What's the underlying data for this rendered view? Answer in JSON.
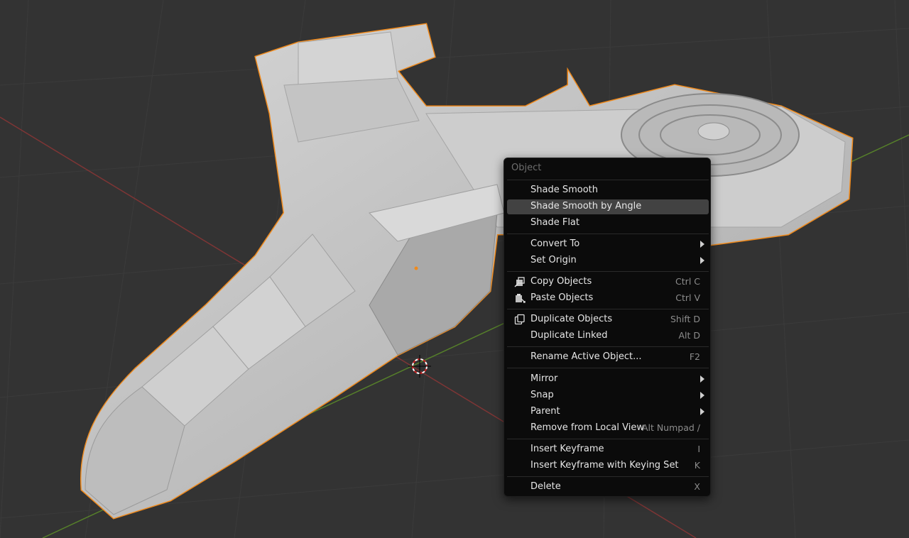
{
  "context_menu": {
    "title": "Object",
    "items": [
      {
        "label": "Shade Smooth",
        "shortcut": "",
        "submenu": false
      },
      {
        "label": "Shade Smooth by Angle",
        "shortcut": "",
        "submenu": false,
        "highlighted": true
      },
      {
        "label": "Shade Flat",
        "shortcut": "",
        "submenu": false
      },
      {
        "label": "Convert To",
        "shortcut": "",
        "submenu": true
      },
      {
        "label": "Set Origin",
        "shortcut": "",
        "submenu": true
      },
      {
        "label": "Copy Objects",
        "shortcut": "Ctrl C",
        "submenu": false,
        "icon": "copy-icon"
      },
      {
        "label": "Paste Objects",
        "shortcut": "Ctrl V",
        "submenu": false,
        "icon": "paste-icon"
      },
      {
        "label": "Duplicate Objects",
        "shortcut": "Shift D",
        "submenu": false,
        "icon": "duplicate-icon"
      },
      {
        "label": "Duplicate Linked",
        "shortcut": "Alt D",
        "submenu": false
      },
      {
        "label": "Rename Active Object...",
        "shortcut": "F2",
        "submenu": false
      },
      {
        "label": "Mirror",
        "shortcut": "",
        "submenu": true
      },
      {
        "label": "Snap",
        "shortcut": "",
        "submenu": true
      },
      {
        "label": "Parent",
        "shortcut": "",
        "submenu": true
      },
      {
        "label": "Remove from Local View",
        "shortcut": "Alt Numpad /",
        "submenu": false
      },
      {
        "label": "Insert Keyframe",
        "shortcut": "I",
        "submenu": false
      },
      {
        "label": "Insert Keyframe with Keying Set",
        "shortcut": "K",
        "submenu": false
      },
      {
        "label": "Delete",
        "shortcut": "X",
        "submenu": false
      }
    ]
  },
  "colors": {
    "viewport_bg": "#333333",
    "grid": "#3d3d3d",
    "x_axis": "#8a3a3a",
    "y_axis": "#5e8a2e",
    "selection_outline": "#f08a1c",
    "model_fill": "#c8c8c8",
    "menu_bg": "#0b0b0b",
    "menu_highlight": "#424242"
  }
}
